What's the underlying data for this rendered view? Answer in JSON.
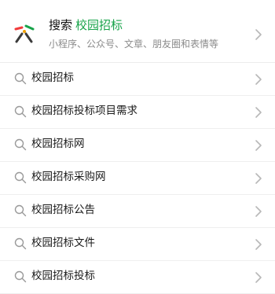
{
  "search_card": {
    "prefix": "搜索",
    "keyword": "校园招标",
    "subtitle": "小程序、公众号、文章、朋友圈和表情等",
    "icon": "search-logo-icon",
    "accent_color": "#18a34a"
  },
  "suggestions": [
    {
      "label": "校园招标"
    },
    {
      "label": "校园招标投标项目需求"
    },
    {
      "label": "校园招标网"
    },
    {
      "label": "校园招标采购网"
    },
    {
      "label": "校园招标公告"
    },
    {
      "label": "校园招标文件"
    },
    {
      "label": "校园招标投标"
    }
  ]
}
